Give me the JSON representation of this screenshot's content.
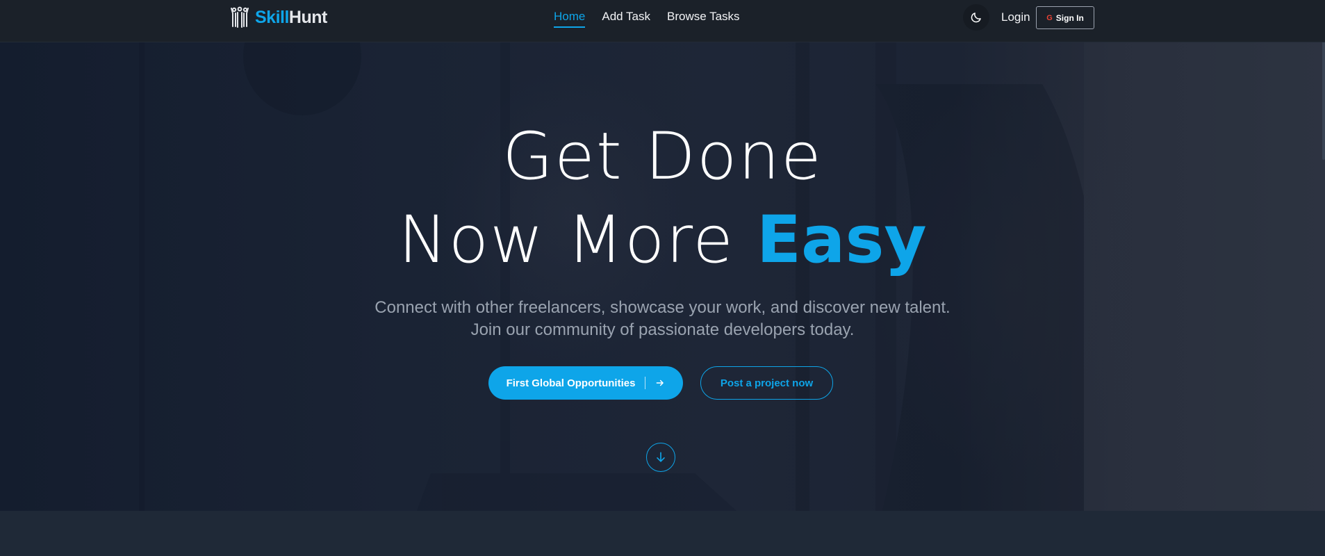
{
  "brand": {
    "part1": "Skill",
    "part2": "Hunt"
  },
  "nav": {
    "links": [
      {
        "label": "Home"
      },
      {
        "label": "Add Task"
      },
      {
        "label": "Browse Tasks"
      }
    ],
    "login_label": "Login",
    "signin_label": "Sign In",
    "google_glyph": "G"
  },
  "hero": {
    "headline_line1": "Get Done",
    "headline_line2_prefix": "Now More ",
    "headline_accent": "Easy",
    "subtitle_line1": "Connect with other freelancers, showcase your work, and discover new talent.",
    "subtitle_line2": "Join our community of passionate developers today.",
    "primary_cta": "First Global Opportunities",
    "secondary_cta": "Post a project now"
  },
  "colors": {
    "accent": "#0ea5e9",
    "navbar_bg": "#1b2129",
    "hero_bg": "#1a2334"
  },
  "icons": {
    "logo": "people-group-icon",
    "theme": "moon-icon",
    "cta_arrow": "arrow-right-icon",
    "scroll": "arrow-down-circle-icon"
  }
}
